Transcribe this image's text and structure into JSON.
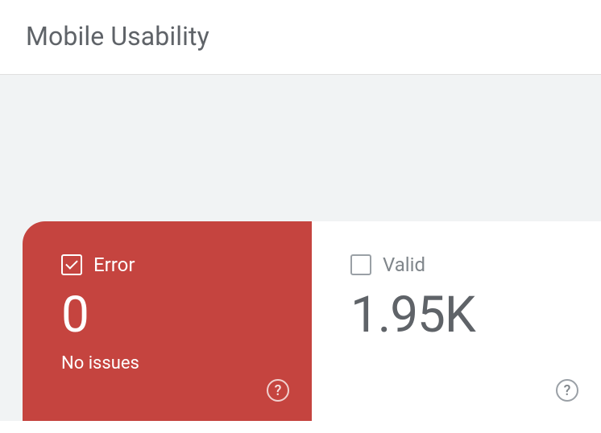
{
  "header": {
    "title": "Mobile Usability"
  },
  "cards": {
    "error": {
      "label": "Error",
      "value": "0",
      "subtext": "No issues"
    },
    "valid": {
      "label": "Valid",
      "value": "1.95K"
    }
  }
}
